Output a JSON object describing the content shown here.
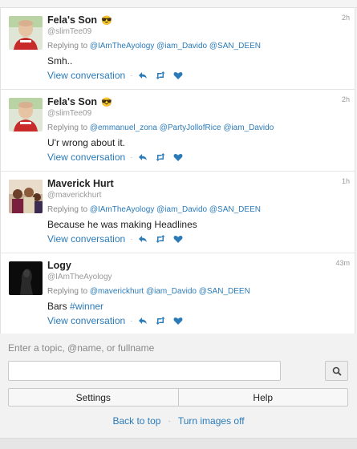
{
  "tweets": [
    {
      "name": "Fela's Son",
      "emoji": "😎",
      "handle": "@slimTee09",
      "time": "2h",
      "replying_prefix": "Replying to",
      "mentions": [
        "@IAmTheAyology",
        "@iam_Davido",
        "@SAN_DEEN"
      ],
      "text": "Smh..",
      "hashtag": "",
      "view_conversation": "View conversation",
      "avatar": "boy-red-shirt"
    },
    {
      "name": "Fela's Son",
      "emoji": "😎",
      "handle": "@slimTee09",
      "time": "2h",
      "replying_prefix": "Replying to",
      "mentions": [
        "@emmanuel_zona",
        "@PartyJollofRice",
        "@iam_Davido"
      ],
      "text": "U'r wrong about it.",
      "hashtag": "",
      "view_conversation": "View conversation",
      "avatar": "boy-red-shirt"
    },
    {
      "name": "Maverick Hurt",
      "emoji": "",
      "handle": "@maverickhurt",
      "time": "1h",
      "replying_prefix": "Replying to",
      "mentions": [
        "@IAmTheAyology",
        "@iam_Davido",
        "@SAN_DEEN"
      ],
      "text": "Because he was making Headlines",
      "hashtag": "",
      "view_conversation": "View conversation",
      "avatar": "group-photo"
    },
    {
      "name": "Logy",
      "emoji": "",
      "handle": "@IAmTheAyology",
      "time": "43m",
      "replying_prefix": "Replying to",
      "mentions": [
        "@maverickhurt",
        "@iam_Davido",
        "@SAN_DEEN"
      ],
      "text": "Bars",
      "hashtag": "#winner",
      "view_conversation": "View conversation",
      "avatar": "dark-silhouette"
    }
  ],
  "search": {
    "label": "Enter a topic, @name, or fullname",
    "value": "",
    "placeholder": ""
  },
  "buttons": {
    "settings": "Settings",
    "help": "Help"
  },
  "footer": {
    "back_to_top": "Back to top",
    "separator": "·",
    "turn_images_off": "Turn images off"
  },
  "icons": {
    "reply": "reply-icon",
    "retweet": "retweet-icon",
    "like": "heart-icon",
    "search": "search-icon"
  },
  "colors": {
    "link": "#2b7bb9",
    "muted": "#999999",
    "icon": "#2b7bb9"
  }
}
